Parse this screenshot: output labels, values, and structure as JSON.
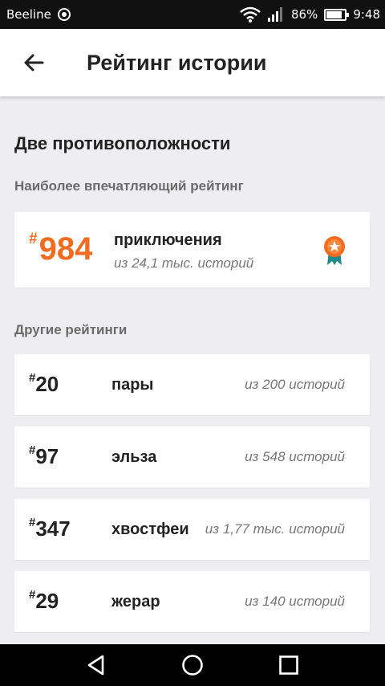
{
  "status_bar": {
    "carrier": "Beeline",
    "battery_percent": "86%",
    "battery_level": 0.86,
    "time": "9:48"
  },
  "app_bar": {
    "title": "Рейтинг истории"
  },
  "story": {
    "title": "Две противоположности"
  },
  "best_section": {
    "label": "Наиболее впечатляющий рейтинг",
    "hash": "#",
    "rank": "984",
    "tag": "приключения",
    "of_text": "из 24,1 тыс. историй"
  },
  "other_section": {
    "label": "Другие рейтинги",
    "items": [
      {
        "hash": "#",
        "rank": "20",
        "tag": "пары",
        "of_text": "из 200 историй"
      },
      {
        "hash": "#",
        "rank": "97",
        "tag": "эльза",
        "of_text": "из 548 историй"
      },
      {
        "hash": "#",
        "rank": "347",
        "tag": "хвостфеи",
        "of_text": "из 1,77 тыс. историй"
      },
      {
        "hash": "#",
        "rank": "29",
        "tag": "жерар",
        "of_text": "из 140 историй"
      }
    ]
  },
  "colors": {
    "accent": "#f26b21",
    "medal_ribbon": "#1e8a8a",
    "background": "#eeedef"
  }
}
